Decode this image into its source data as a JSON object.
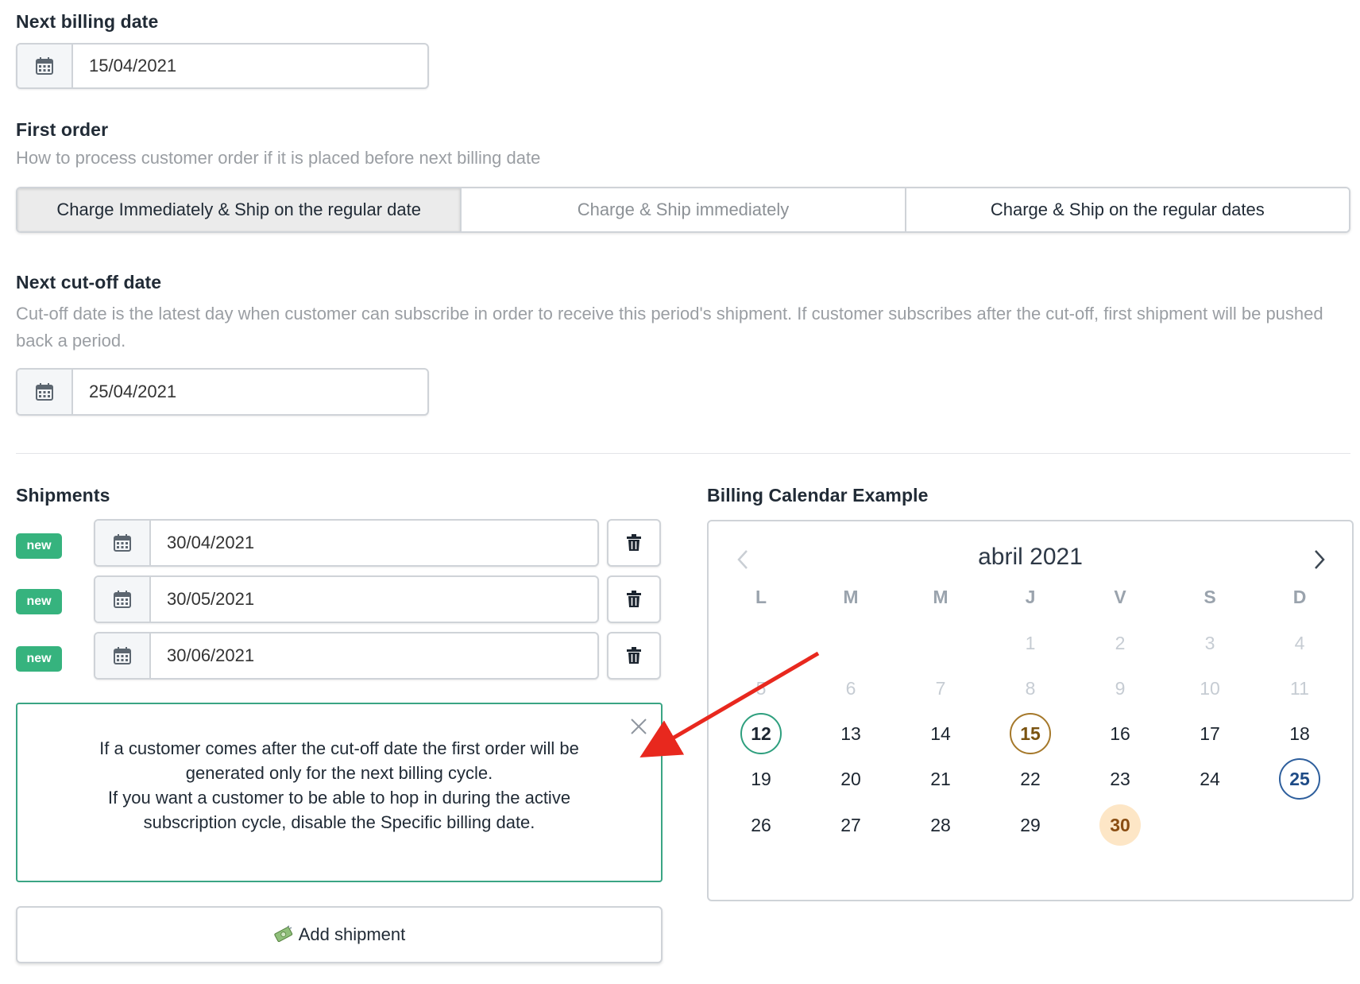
{
  "next_billing": {
    "label": "Next billing date",
    "value": "15/04/2021",
    "icon": "calendar-icon"
  },
  "first_order": {
    "label": "First order",
    "help": "How to process customer order if it is placed before next billing date",
    "options": [
      "Charge Immediately & Ship on the regular date",
      "Charge & Ship immediately",
      "Charge & Ship on the regular dates"
    ],
    "selected": "Charge Immediately & Ship on the regular date"
  },
  "cutoff": {
    "label": "Next cut-off date",
    "help": "Cut-off date is the latest day when customer can subscribe in order to receive this period's shipment. If customer subscribes after the cut-off, first shipment will be pushed back a period.",
    "value": "25/04/2021"
  },
  "shipments": {
    "label": "Shipments",
    "items": [
      {
        "badge": "new",
        "date": "30/04/2021"
      },
      {
        "badge": "new",
        "date": "30/05/2021"
      },
      {
        "badge": "new",
        "date": "30/06/2021"
      }
    ],
    "notice_lines": [
      "If a customer comes after the cut-off date the first order will be",
      "generated only for the next billing cycle.",
      "If you want a customer to be able to hop in during the active",
      "subscription cycle, disable the Specific billing date."
    ],
    "add_label": "Add shipment",
    "add_icon": "money-icon"
  },
  "calendar": {
    "label": "Billing Calendar Example",
    "title": "abril 2021",
    "weekdays": [
      "L",
      "M",
      "M",
      "J",
      "V",
      "S",
      "D"
    ],
    "weeks": [
      [
        "",
        "",
        "",
        "1",
        "2",
        "3",
        "4"
      ],
      [
        "5",
        "6",
        "7",
        "8",
        "9",
        "10",
        "11"
      ],
      [
        "12",
        "13",
        "14",
        "15",
        "16",
        "17",
        "18"
      ],
      [
        "19",
        "20",
        "21",
        "22",
        "23",
        "24",
        "25"
      ],
      [
        "26",
        "27",
        "28",
        "29",
        "30",
        "",
        ""
      ]
    ],
    "muted_days": [
      "1",
      "2",
      "3",
      "4",
      "5",
      "6",
      "7",
      "8",
      "9",
      "10",
      "11"
    ],
    "highlights": {
      "12": "ring-green",
      "15": "ring-brown",
      "25": "ring-blue",
      "30": "fill-peach"
    },
    "colors": {
      "green": "#2e9f7e",
      "brown": "#a5782a",
      "blue": "#2d5e9c",
      "peach": "#fde6c6",
      "arrow": "#e8281e"
    }
  }
}
